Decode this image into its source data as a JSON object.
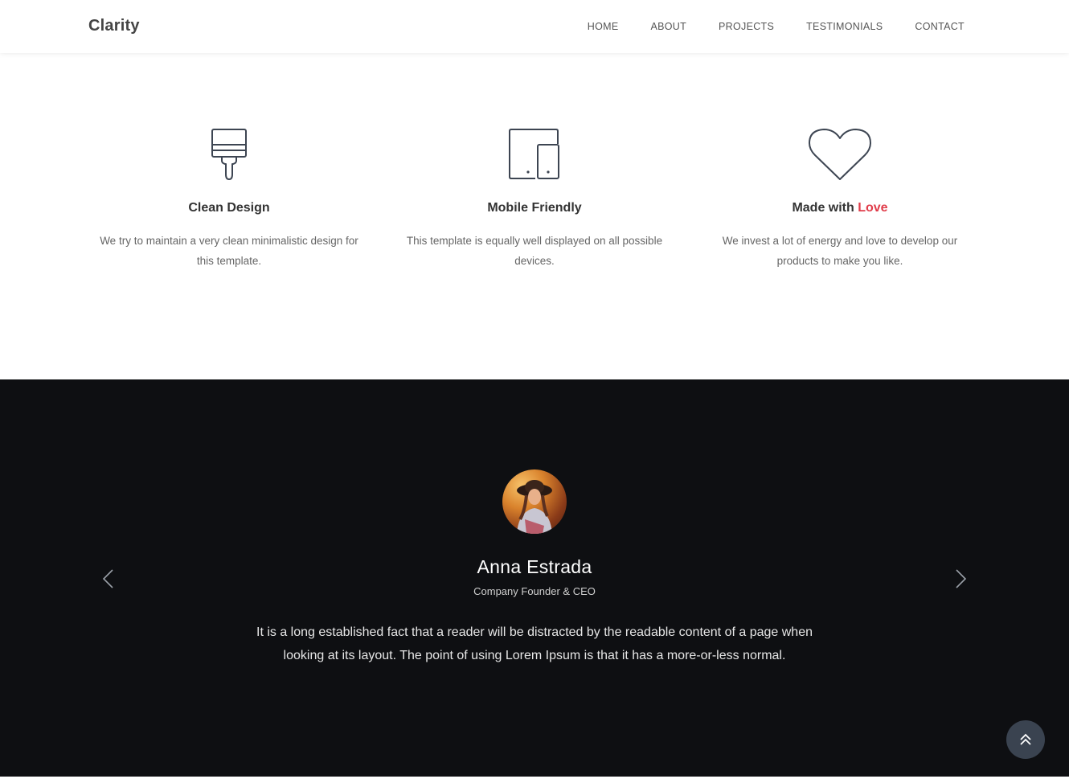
{
  "header": {
    "brand": "Clarity",
    "nav": [
      "HOME",
      "ABOUT",
      "PROJECTS",
      "TESTIMONIALS",
      "CONTACT"
    ]
  },
  "features": [
    {
      "icon": "paint-brush-icon",
      "title": "Clean Design",
      "text": "We try to maintain a very clean minimalistic design for this template."
    },
    {
      "icon": "devices-icon",
      "title": "Mobile Friendly",
      "text": "This template is equally well displayed on all possible devices."
    },
    {
      "icon": "heart-icon",
      "title_prefix": "Made with ",
      "title_accent": "Love",
      "text": "We invest a lot of energy and love to develop our products to make you like."
    }
  ],
  "testimonial": {
    "name": "Anna Estrada",
    "role": "Company Founder & CEO",
    "quote": "It is a long established fact that a reader will be distracted by the readable content of a page when looking at its layout. The point of using Lorem Ipsum is that it has a more-or-less normal."
  },
  "colors": {
    "accent": "#e03c4a",
    "dark_bg": "#0e0f12",
    "to_top_bg": "#3a4350"
  }
}
